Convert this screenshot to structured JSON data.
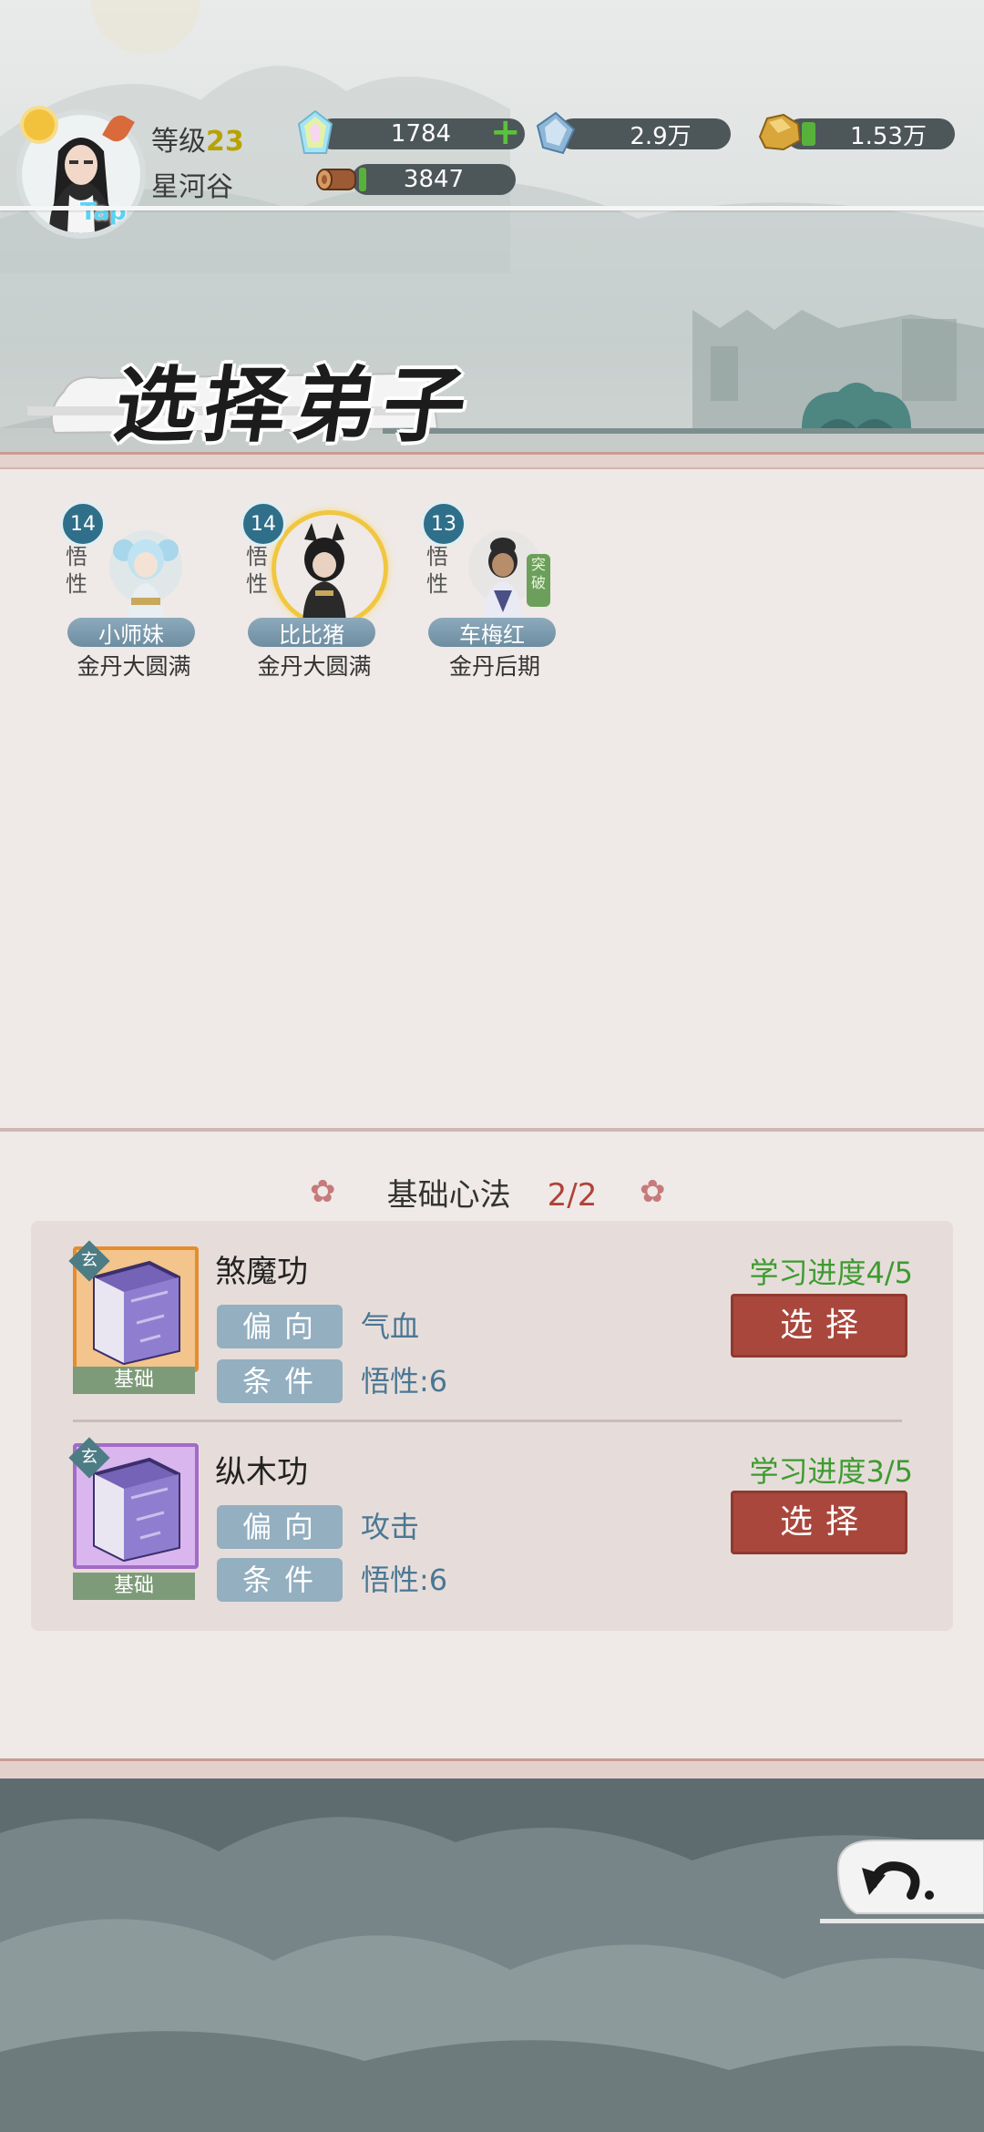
{
  "player": {
    "level_label": "等级",
    "level": "23",
    "sect_name": "星河谷",
    "tap_label": "Tap",
    "avatar_icon": "player-avatar"
  },
  "resources": [
    {
      "name": "spirit-stone",
      "icon": "rainbow-crystal-icon",
      "value": "1784",
      "has_plus": true
    },
    {
      "name": "crystal",
      "icon": "blue-crystal-icon",
      "value": "2.9万"
    },
    {
      "name": "ore",
      "icon": "gold-ore-icon",
      "value": "1.53万",
      "fill_fraction": 0.08
    },
    {
      "name": "wood",
      "icon": "wood-log-icon",
      "value": "3847",
      "fill_fraction": 0.03
    }
  ],
  "page_title": "选择弟子",
  "disciples": [
    {
      "wuxing_value": "14",
      "wuxing_label": "悟性",
      "name": "小师妹",
      "realm": "金丹大圆满",
      "selected": false,
      "breakthrough": ""
    },
    {
      "wuxing_value": "14",
      "wuxing_label": "悟性",
      "name": "比比猪",
      "realm": "金丹大圆满",
      "selected": true,
      "breakthrough": ""
    },
    {
      "wuxing_value": "13",
      "wuxing_label": "悟性",
      "name": "车梅红",
      "realm": "金丹后期",
      "selected": false,
      "breakthrough": "突破"
    }
  ],
  "technique_section": {
    "title": "基础心法",
    "count": "2/2"
  },
  "techniques": [
    {
      "name": "煞魔功",
      "grade_tag": "基础",
      "corner_mark": "玄",
      "bias_label": "偏向",
      "bias_value": "气血",
      "cond_label": "条件",
      "cond_value": "悟性:6",
      "progress": "学习进度4/5",
      "button": "选择"
    },
    {
      "name": "纵木功",
      "grade_tag": "基础",
      "corner_mark": "玄",
      "bias_label": "偏向",
      "bias_value": "攻击",
      "cond_label": "条件",
      "cond_value": "悟性:6",
      "progress": "学习进度3/5",
      "button": "选择"
    }
  ],
  "back_icon": "back-arrow-icon",
  "colors": {
    "accent_red": "#a9473d",
    "progress_green": "#3d9b2f",
    "pill_blue": "#93afc0",
    "resource_bar": "#4d5659"
  }
}
